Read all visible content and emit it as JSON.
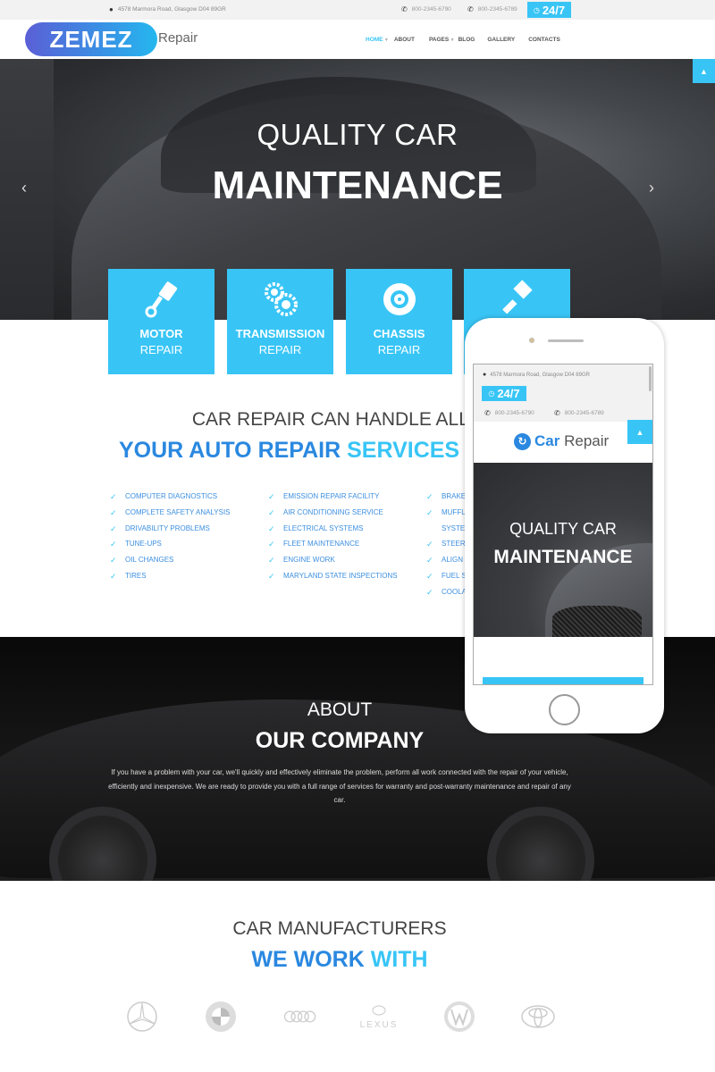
{
  "topbar": {
    "address": "4578 Marmora Road, Glasgow D04 89GR",
    "phones": [
      "800-2345-6790",
      "800-2345-6789"
    ],
    "badge": "24/7",
    "icons": {
      "address": "map-pin-icon",
      "phone": "phone-icon",
      "clock": "clock-icon"
    }
  },
  "header": {
    "logo_text": "ZEMEZ",
    "logo_sub": "Repair",
    "nav": [
      {
        "label": "HOME",
        "active": true,
        "has_dropdown": true
      },
      {
        "label": "ABOUT",
        "active": false,
        "has_dropdown": false
      },
      {
        "label": "PAGES",
        "active": false,
        "has_dropdown": true
      },
      {
        "label": "BLOG",
        "active": false,
        "has_dropdown": false
      },
      {
        "label": "GALLERY",
        "active": false,
        "has_dropdown": false
      },
      {
        "label": "CONTACTS",
        "active": false,
        "has_dropdown": false
      }
    ]
  },
  "hero": {
    "line1": "QUALITY CAR",
    "line2": "MAINTENANCE",
    "prev": "‹",
    "next": "›"
  },
  "services": [
    {
      "icon": "piston-icon",
      "title": "MOTOR",
      "sub": "REPAIR"
    },
    {
      "icon": "gears-icon",
      "title": "TRANSMISSION",
      "sub": "REPAIR"
    },
    {
      "icon": "brake-disc-icon",
      "title": "CHASSIS",
      "sub": "REPAIR"
    },
    {
      "icon": "paint-brush-icon",
      "title": "",
      "sub": ""
    }
  ],
  "services_section": {
    "title": "CAR REPAIR CAN HANDLE ALL C",
    "subtitle_a": "YOUR AUTO REPAIR ",
    "subtitle_b": "SERVICES IN",
    "col1": [
      "COMPUTER DIAGNOSTICS",
      "COMPLETE SAFETY ANALYSIS",
      "DRIVABILITY PROBLEMS",
      "TUNE-UPS",
      "OIL CHANGES",
      "TIRES"
    ],
    "col2": [
      "EMISSION REPAIR FACILITY",
      "AIR CONDITIONING SERVICE",
      "ELECTRICAL SYSTEMS",
      "FLEET MAINTENANCE",
      "ENGINE WORK",
      "MARYLAND STATE INSPECTIONS"
    ],
    "col3": [
      "BRAKE",
      "MUFFL",
      "SYSTEI",
      "STEERI",
      "ALIGN",
      "FUEL S",
      "COOLA"
    ]
  },
  "about": {
    "title": "ABOUT",
    "subtitle": "OUR COMPANY",
    "text": "If you have a problem with your car, we'll quickly and effectively eliminate the problem, perform all work connected with the repair of your vehicle, efficiently and inexpensive. We are ready to provide you with a full range of services for warranty and post-warranty maintenance and repair of any car."
  },
  "manufacturers": {
    "title": "CAR MANUFACTURERS",
    "subtitle_a": "WE WORK ",
    "subtitle_b": "WITH",
    "brands": [
      "Mercedes-Benz",
      "BMW",
      "Audi",
      "Lexus",
      "Volkswagen",
      "Toyota"
    ]
  },
  "phone_mockup": {
    "address": "4578 Marmora Road, Glasgow D04 89GR",
    "badge": "24/7",
    "phones": [
      "800-2345-6790",
      "800-2345-6789"
    ],
    "logo_a": "Car",
    "logo_b": " Repair",
    "hero_line1": "QUALITY CAR",
    "hero_line2": "MAINTENANCE"
  },
  "colors": {
    "accent": "#38c5f6",
    "brand_blue": "#2a88e0",
    "topbar_bg": "#f2f2f2"
  }
}
